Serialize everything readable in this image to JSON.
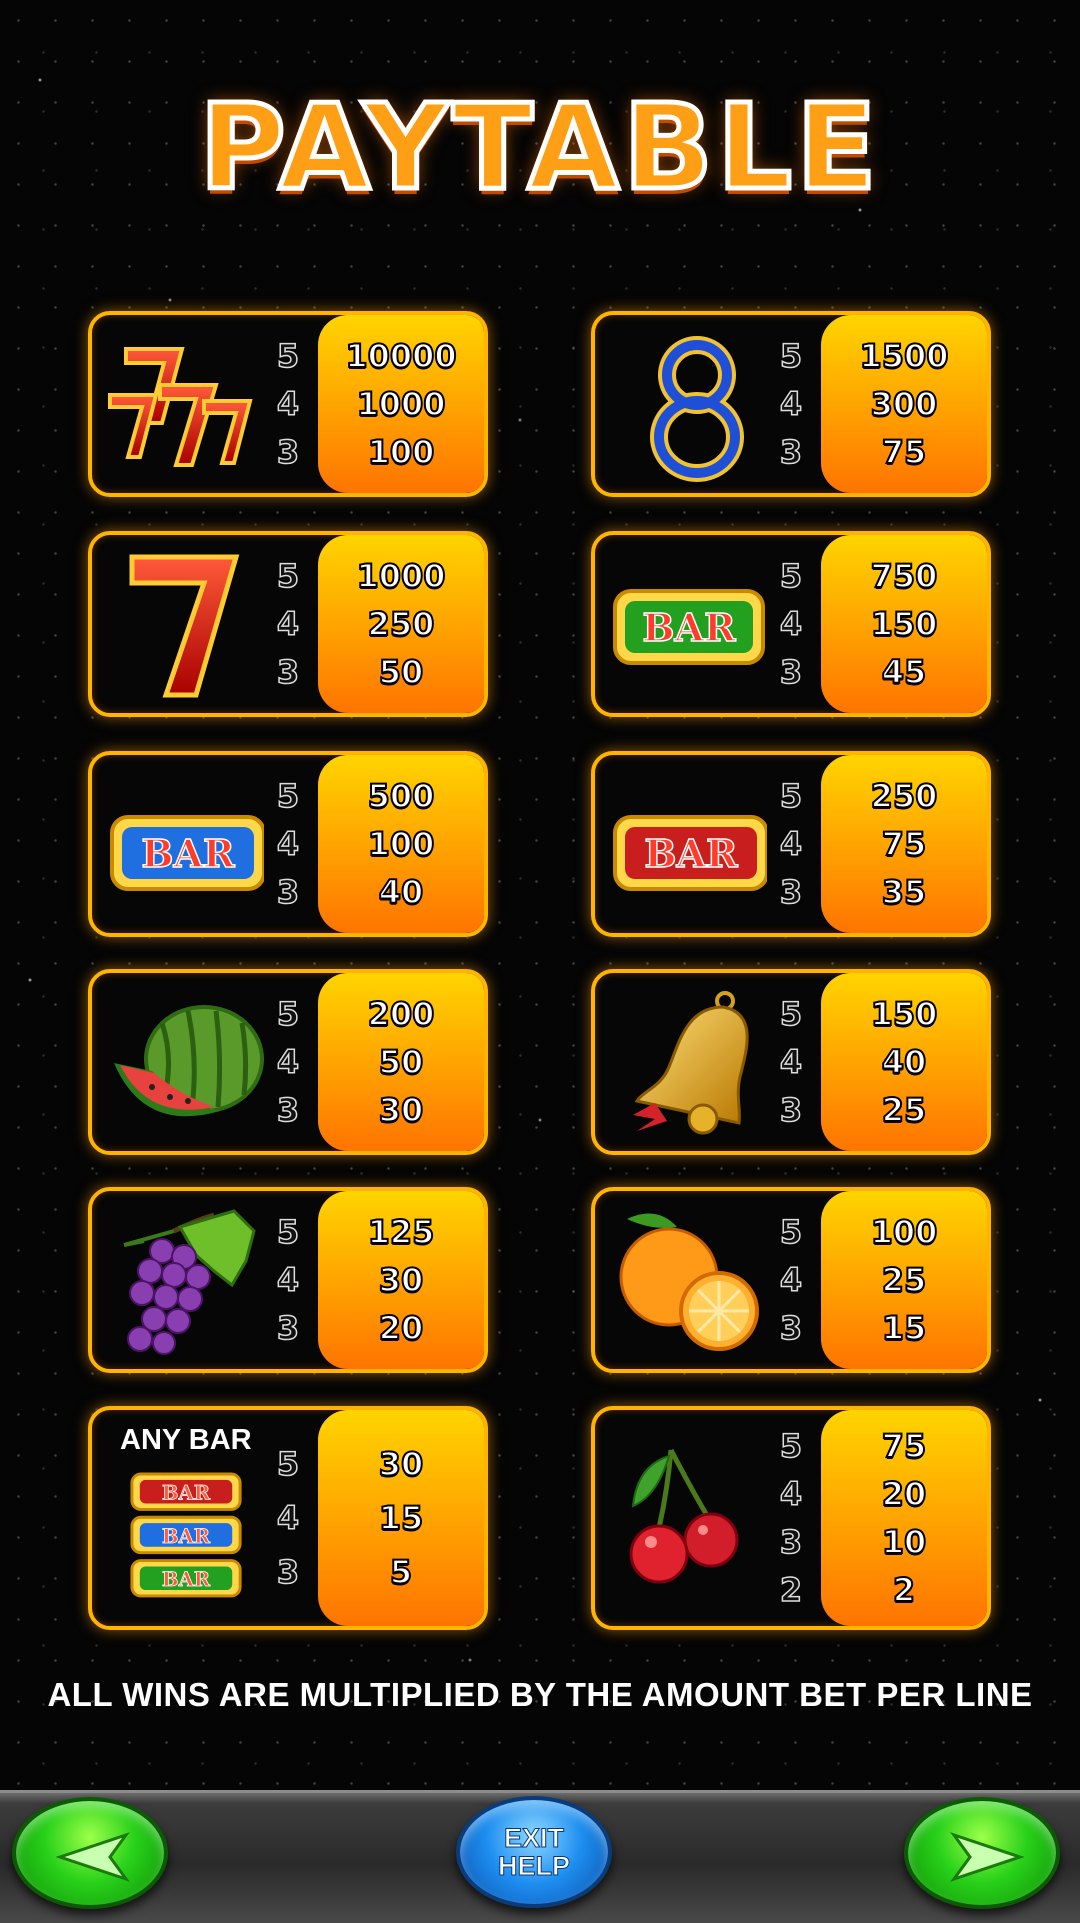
{
  "title": "PAYTABLE",
  "panels": [
    {
      "symbol": "triple-seven",
      "counts": [
        "5",
        "4",
        "3"
      ],
      "pays": [
        "10000",
        "1000",
        "100"
      ]
    },
    {
      "symbol": "blue-eight",
      "counts": [
        "5",
        "4",
        "3"
      ],
      "pays": [
        "1500",
        "300",
        "75"
      ]
    },
    {
      "symbol": "red-seven",
      "counts": [
        "5",
        "4",
        "3"
      ],
      "pays": [
        "1000",
        "250",
        "50"
      ]
    },
    {
      "symbol": "green-bar",
      "bar_text": "BAR",
      "counts": [
        "5",
        "4",
        "3"
      ],
      "pays": [
        "750",
        "150",
        "45"
      ]
    },
    {
      "symbol": "blue-bar",
      "bar_text": "BAR",
      "counts": [
        "5",
        "4",
        "3"
      ],
      "pays": [
        "500",
        "100",
        "40"
      ]
    },
    {
      "symbol": "red-bar",
      "bar_text": "BAR",
      "counts": [
        "5",
        "4",
        "3"
      ],
      "pays": [
        "250",
        "75",
        "35"
      ]
    },
    {
      "symbol": "watermelon",
      "counts": [
        "5",
        "4",
        "3"
      ],
      "pays": [
        "200",
        "50",
        "30"
      ]
    },
    {
      "symbol": "bell",
      "counts": [
        "5",
        "4",
        "3"
      ],
      "pays": [
        "150",
        "40",
        "25"
      ]
    },
    {
      "symbol": "grapes",
      "counts": [
        "5",
        "4",
        "3"
      ],
      "pays": [
        "125",
        "30",
        "20"
      ]
    },
    {
      "symbol": "orange",
      "counts": [
        "5",
        "4",
        "3"
      ],
      "pays": [
        "100",
        "25",
        "15"
      ]
    },
    {
      "symbol": "any-bar",
      "label": "ANY BAR",
      "bar_text": "BAR",
      "counts": [
        "5",
        "4",
        "3"
      ],
      "pays": [
        "30",
        "15",
        "5"
      ]
    },
    {
      "symbol": "cherry",
      "counts": [
        "5",
        "4",
        "3",
        "2"
      ],
      "pays": [
        "75",
        "20",
        "10",
        "2"
      ]
    }
  ],
  "footer": "ALL WINS ARE MULTIPLIED BY THE AMOUNT BET PER LINE",
  "buttons": {
    "exit_line1": "EXIT",
    "exit_line2": "HELP"
  },
  "colors": {
    "panel_border": "#ffb400",
    "pay_top": "#ffd400",
    "pay_bottom": "#ff7400",
    "title": "#ff9f15",
    "arrow_button": "#28d11a",
    "exit_button": "#1d8df0"
  },
  "icons": {
    "prev": "arrow-left-icon",
    "next": "arrow-right-icon"
  }
}
